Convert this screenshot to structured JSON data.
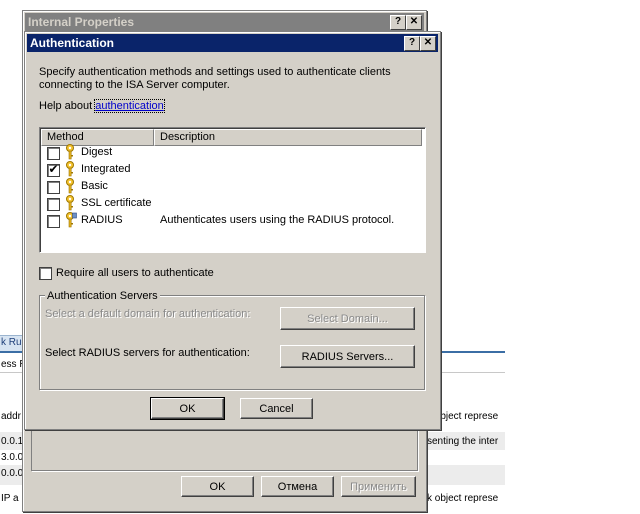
{
  "background": {
    "tab_label": "k Ru",
    "header_fragment": "ess R",
    "left_fragments": [
      "addr",
      "0.0.1",
      "3.0.0",
      "0.0.0",
      " IP a"
    ],
    "right_fragments": [
      "k object represe",
      "senting the inter",
      "k object represe"
    ]
  },
  "parent_dialog": {
    "title": "Internal Properties",
    "help_glyph": "?",
    "close_glyph": "✕",
    "ok_label": "OK",
    "cancel_label": "Отмена",
    "apply_label": "Применить"
  },
  "auth_dialog": {
    "title": "Authentication",
    "help_glyph": "?",
    "close_glyph": "✕",
    "intro_text": "Specify authentication methods and settings used to authenticate clients connecting to the ISA Server computer.",
    "help_prefix": "Help about ",
    "help_link": "authentication",
    "columns": {
      "method": "Method",
      "description": "Description"
    },
    "methods": [
      {
        "name": "Digest",
        "description": "",
        "checked": false,
        "icon": "key-icon"
      },
      {
        "name": "Integrated",
        "description": "",
        "checked": true,
        "icon": "key-icon"
      },
      {
        "name": "Basic",
        "description": "",
        "checked": false,
        "icon": "key-icon"
      },
      {
        "name": "SSL certificate",
        "description": "",
        "checked": false,
        "icon": "key-icon"
      },
      {
        "name": "RADIUS",
        "description": "Authenticates users using the RADIUS protocol.",
        "checked": false,
        "icon": "key-server-icon"
      }
    ],
    "require_all_label": "Require all users to authenticate",
    "require_all_checked": false,
    "servers_group_title": "Authentication Servers",
    "default_domain_text": "Select a default domain for authentication:",
    "select_domain_label": "Select Domain...",
    "radius_text": "Select RADIUS servers for authentication:",
    "radius_servers_label": "RADIUS Servers...",
    "ok_label": "OK",
    "cancel_label": "Cancel"
  }
}
